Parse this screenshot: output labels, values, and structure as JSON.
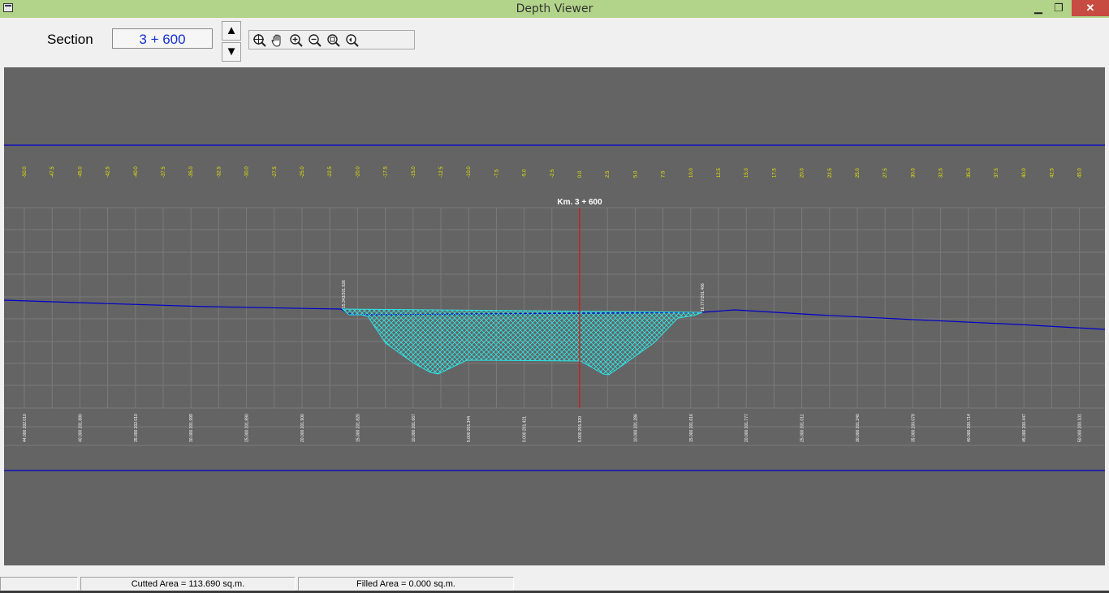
{
  "window": {
    "title": "Depth Viewer",
    "minimize": "▁",
    "maximize": "❐",
    "close": "✕"
  },
  "section": {
    "label": "Section",
    "value": "3 + 600",
    "up": "▲",
    "down": "▼"
  },
  "toolbar": {
    "icons": [
      "zoom-extents-icon",
      "pan-hand-icon",
      "zoom-in-icon",
      "zoom-out-icon",
      "zoom-window-icon",
      "zoom-previous-icon"
    ]
  },
  "chart_data": {
    "type": "cross-section",
    "title": "Km. 3 + 600",
    "offset_labels": [
      "-50.0",
      "-47.5",
      "-45.0",
      "-42.5",
      "-40.0",
      "-37.5",
      "-35.0",
      "-32.5",
      "-30.0",
      "-27.5",
      "-25.0",
      "-22.5",
      "-20.0",
      "-17.5",
      "-15.0",
      "-12.5",
      "-10.0",
      "-7.5",
      "-5.0",
      "-2.5",
      "0.0",
      "2.5",
      "5.0",
      "7.5",
      "10.0",
      "12.5",
      "15.0",
      "17.5",
      "20.0",
      "22.5",
      "25.0",
      "27.5",
      "30.0",
      "32.5",
      "35.0",
      "37.5",
      "40.0",
      "42.5",
      "45.0",
      "47.5",
      "50.0"
    ],
    "point_labels": [
      "44.000  202.010",
      "40.000  201.880",
      "35.000  202.010",
      "30.000  201.999",
      "25.000  201.890",
      "20.000  201.900",
      "15.000  201.820",
      "10.000  201.667",
      "5.000  201.344",
      "0.000  201.421",
      "5.000  201.320",
      "10.000  201.286",
      "15.000  201.616",
      "20.000  201.777",
      "25.000  201.011",
      "30.000  201.240",
      "35.000  200.079",
      "40.000  200.714",
      "45.000  200.447",
      "50.000  200.101"
    ],
    "left_catch_label": "15.343/201.926",
    "right_catch_label": "16.777/201.466",
    "colors": {
      "ground": "#0000cc",
      "cut": "#2ee3e3",
      "centerline": "#e01010",
      "offset_text": "#e8e800",
      "grid": "#7a7a7a"
    }
  },
  "status": {
    "cutted": "Cutted Area = 113.690 sq.m.",
    "filled": "Filled Area = 0.000 sq.m."
  }
}
